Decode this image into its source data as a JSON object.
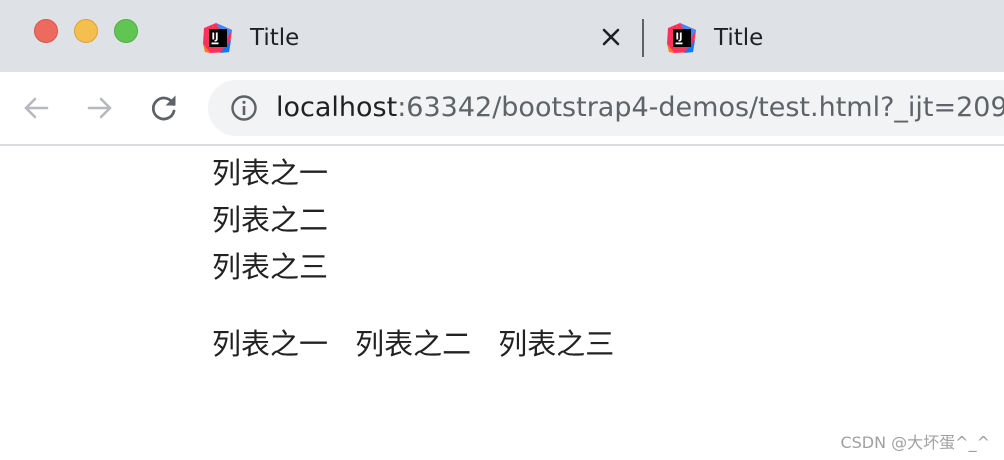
{
  "browser": {
    "tabs": [
      {
        "title": "Title",
        "active": true,
        "favicon": "intellij-idea-icon"
      },
      {
        "title": "Title",
        "active": false,
        "favicon": "intellij-idea-icon"
      }
    ],
    "favicon_text": "IJ",
    "address": {
      "host": "localhost",
      "rest": ":63342/bootstrap4-demos/test.html?_ijt=209"
    },
    "icons": {
      "back": "arrow-left-icon",
      "forward": "arrow-right-icon",
      "reload": "reload-icon",
      "site_info": "info-circle-icon",
      "tab_close": "close-icon"
    },
    "colors": {
      "tabstrip": "#dee1e6",
      "omnibox": "#f1f3f4",
      "traffic_close": "#ed6a5e",
      "traffic_minimize": "#f5bf4f",
      "traffic_maximize": "#61c554"
    }
  },
  "page": {
    "vertical_list": [
      "列表之一",
      "列表之二",
      "列表之三"
    ],
    "horizontal_list": [
      "列表之一",
      "列表之二",
      "列表之三"
    ],
    "watermark": "CSDN @大坏蛋^_^"
  }
}
